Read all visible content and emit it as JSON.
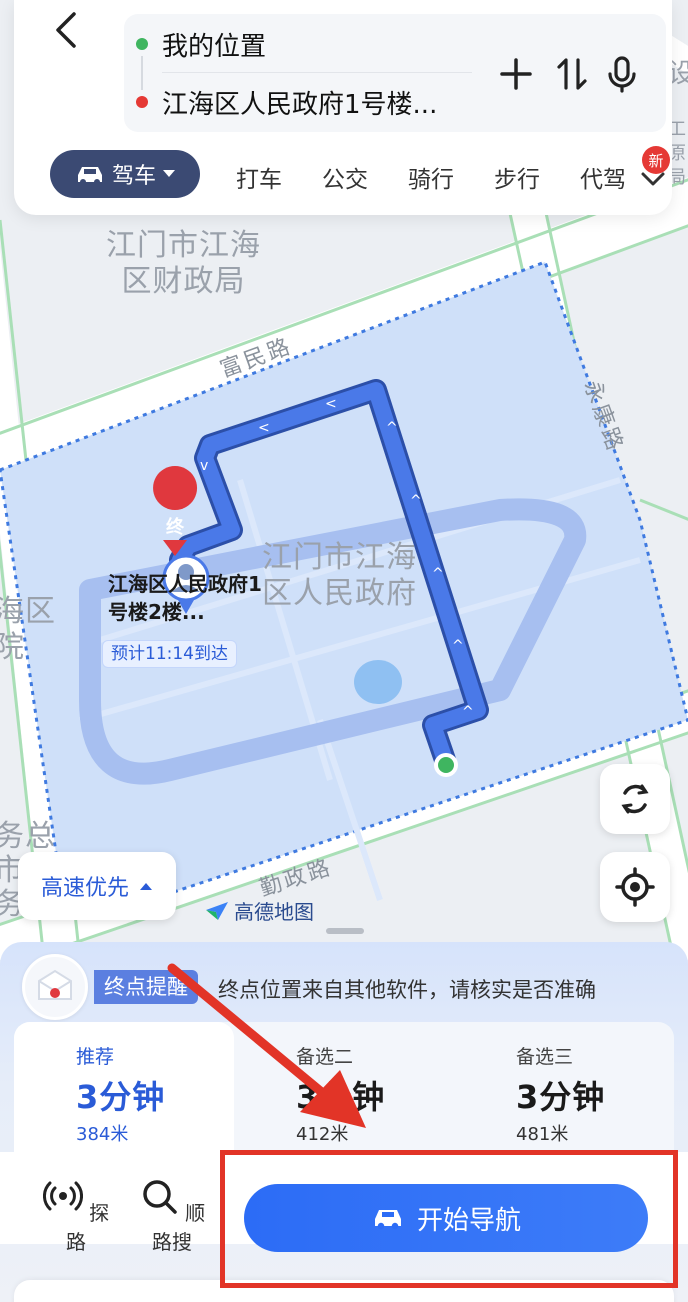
{
  "header": {
    "origin": "我的位置",
    "destination": "江海区人民政府1号楼..."
  },
  "modes": {
    "active": "驾车",
    "items": [
      "打车",
      "公交",
      "骑行",
      "步行",
      "代驾"
    ],
    "new_badge": "新"
  },
  "map": {
    "labels": {
      "finance": "江门市江海\n区财政局",
      "government": "江门市江海\n区人民政府",
      "left_partial": "海区\n院",
      "left_partial2": "务总\n市\n务局",
      "right_partial": "设",
      "right_partial2": "工\n原\n局"
    },
    "roads": {
      "fumin": "富民路",
      "yongkang": "永康路",
      "qinzheng": "勤政路"
    },
    "end_pin": "终",
    "end_label": "江海区人民政府1号楼2楼...",
    "eta": "预计11:14到达",
    "speed_pref": "高速优先",
    "brand": "高德地图"
  },
  "notice": {
    "tag": "终点提醒",
    "text": "终点位置来自其他软件，请核实是否准确"
  },
  "routes": [
    {
      "name": "推荐",
      "time": "3分钟",
      "distance": "384米"
    },
    {
      "name": "备选二",
      "time": "3分钟",
      "distance": "412米"
    },
    {
      "name": "备选三",
      "time": "3分钟",
      "distance": "481米"
    }
  ],
  "actions": {
    "explore": "探路",
    "search_along": "顺路搜",
    "start_nav": "开始导航"
  },
  "colors": {
    "route": "#4a79e8",
    "accent": "#2a5bd7",
    "annotation": "#e23427",
    "origin_dot": "#3fb560",
    "dest_dot": "#e53935"
  }
}
